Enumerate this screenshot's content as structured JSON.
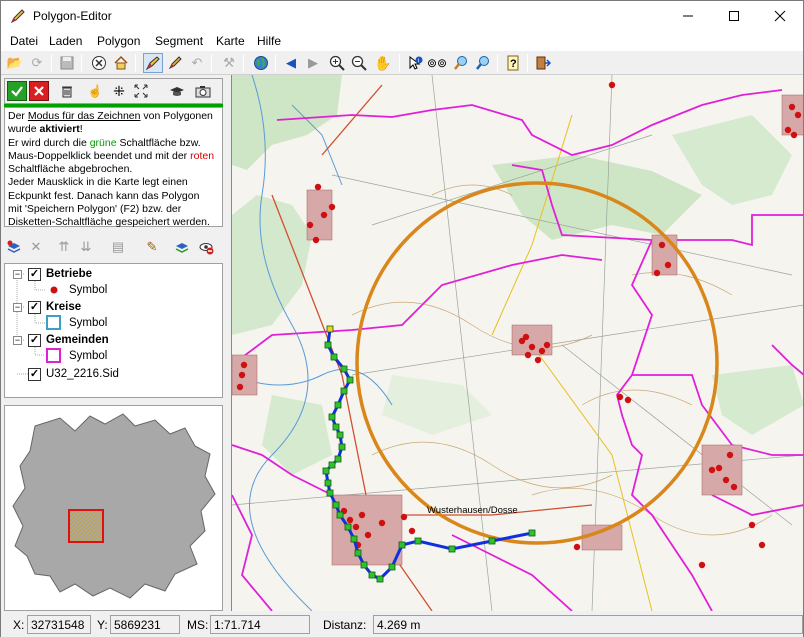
{
  "window": {
    "title": "Polygon-Editor"
  },
  "menu": [
    "Datei",
    "Laden",
    "Polygon",
    "Segment",
    "Karte",
    "Hilfe"
  ],
  "info": {
    "l1a": "Der ",
    "l1b": "Modus für das Zeichnen",
    "l1c": " von Polygonen",
    "l2a": "wurde ",
    "l2b": "aktiviert",
    "l2c": "!",
    "l3a": "Er wird durch die ",
    "l3b": "grüne",
    "l3c": " Schaltfläche bzw.",
    "l4a": "Maus-Doppelklick beendet und mit der ",
    "l4b": "roten",
    "l5": "Schaltfläche abgebrochen.",
    "l6": "Jeder Mausklick in die Karte legt einen",
    "l7": "Eckpunkt fest. Danach kann das Polygon",
    "l8": "mit 'Speichern Polygon' (F2) bzw. der",
    "l9": "Disketten-Schaltfläche gespeichert werden."
  },
  "layers": {
    "betriebe": "Betriebe",
    "kreise": "Kreise",
    "gemeinden": "Gemeinden",
    "symbol": "Symbol",
    "raster": "U32_2216.Sid"
  },
  "map": {
    "place_label": "Wusterhausen/Dosse"
  },
  "status": {
    "x_label": "X:",
    "x_value": "32731548",
    "y_label": "Y:",
    "y_value": "5869231",
    "ms_label": "MS:",
    "ms_value": "1:71.714",
    "dist_label": "Distanz:",
    "dist_value": "4.269 m"
  },
  "colors": {
    "circle": "#d9861a",
    "boundary": "#e020d8",
    "polyline": "#1030e0",
    "vertex": "#30c030",
    "symbol_red": "#d01010",
    "forest": "#c8e4c0"
  }
}
